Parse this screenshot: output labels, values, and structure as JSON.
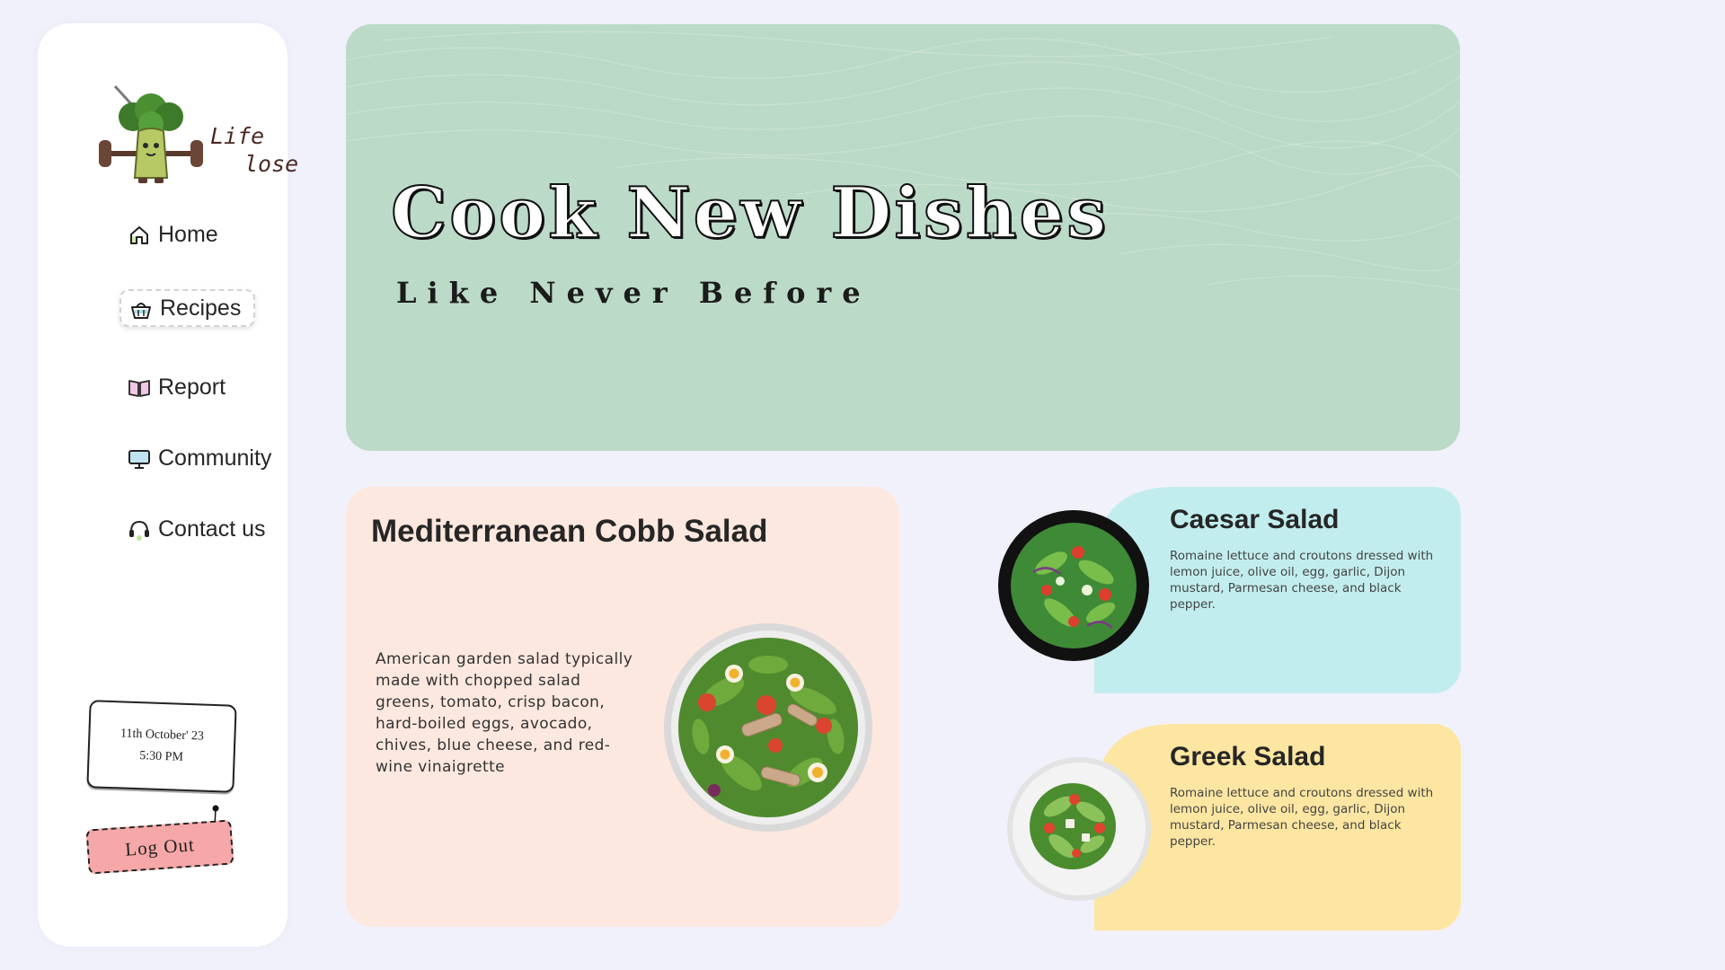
{
  "app": {
    "name": "Life lose",
    "logo_line1": "Life",
    "logo_line2": "lose"
  },
  "sidebar": {
    "items": [
      {
        "label": "Home",
        "icon": "home-icon",
        "active": false
      },
      {
        "label": "Recipes",
        "icon": "basket-icon",
        "active": true
      },
      {
        "label": "Report",
        "icon": "book-icon",
        "active": false
      },
      {
        "label": "Community",
        "icon": "monitor-icon",
        "active": false
      },
      {
        "label": "Contact us",
        "icon": "headset-icon",
        "active": false
      }
    ],
    "date": "11th October' 23",
    "time": "5:30 PM",
    "logout_label": "Log Out"
  },
  "hero": {
    "title": "Cook New Dishes",
    "subtitle": "Like Never Before",
    "color": "#bcdac8"
  },
  "featured": {
    "title": "Mediterranean Cobb Salad",
    "description": "American garden salad typically made with chopped salad greens, tomato, crisp bacon, hard-boiled eggs, avocado, chives, blue cheese, and red-wine vinaigrette",
    "color": "#fde8df"
  },
  "cards": [
    {
      "title": "Caesar Salad",
      "description": "Romaine lettuce and croutons dressed with lemon juice, olive oil, egg, garlic, Dijon mustard, Parmesan cheese, and black pepper.",
      "color": "#c2edee"
    },
    {
      "title": "Greek Salad",
      "description": "Romaine lettuce and croutons dressed with lemon juice, olive oil, egg, garlic, Dijon mustard, Parmesan cheese, and black pepper.",
      "color": "#fde6a2"
    }
  ],
  "colors": {
    "background": "#f1f1fb",
    "logout": "#f6a8a8"
  }
}
